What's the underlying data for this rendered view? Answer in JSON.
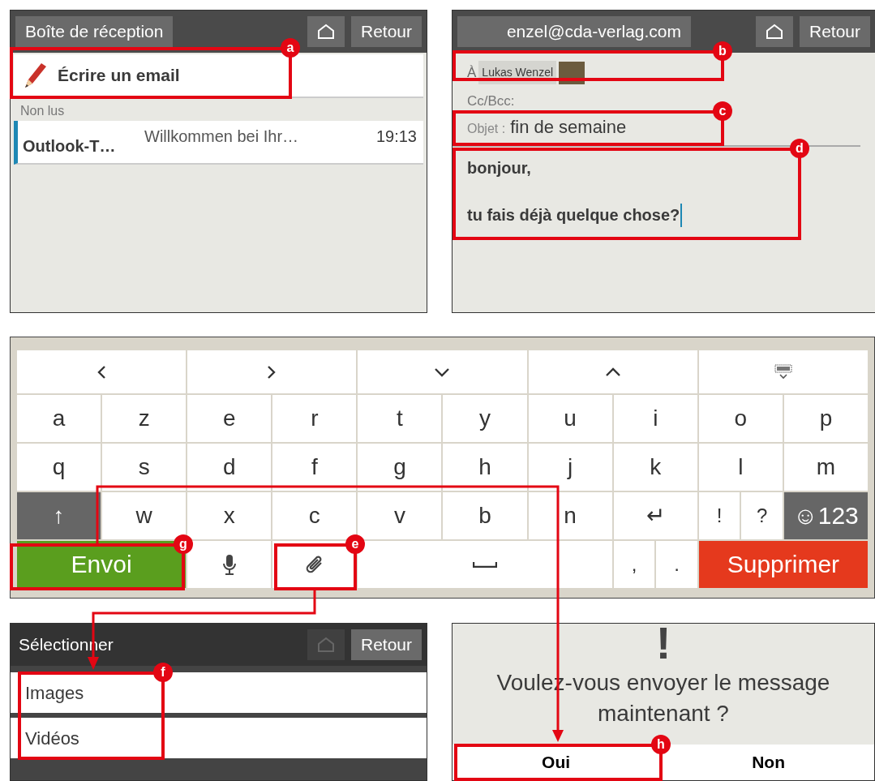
{
  "inbox_screen": {
    "title_button": "Boîte de réception",
    "back_button": "Retour",
    "compose_label": "Écrire un email",
    "section": "Non lus",
    "messages": [
      {
        "sender": "Outlook-T…",
        "preview": "Willkommen bei Ihr…",
        "time": "19:13",
        "unread": true
      }
    ]
  },
  "compose_screen": {
    "account_button": "enzel@cda-verlag.com",
    "back_button": "Retour",
    "to_label": "À",
    "recipient": "Lukas Wenzel",
    "cc_label": "Cc/Bcc:",
    "subject_label": "Objet :",
    "subject": "fin de semaine",
    "body": [
      "bonjour,",
      "tu fais déjà quelque chose?"
    ]
  },
  "keyboard": {
    "rows": [
      {
        "keys": [
          {
            "kind": "left"
          },
          {
            "kind": "right"
          },
          {
            "kind": "down"
          },
          {
            "kind": "up"
          },
          {
            "kind": "hide"
          }
        ]
      },
      {
        "keys": [
          {
            "kind": "letter",
            "label": "a"
          },
          {
            "kind": "letter",
            "label": "z"
          },
          {
            "kind": "letter",
            "label": "e"
          },
          {
            "kind": "letter",
            "label": "r"
          },
          {
            "kind": "letter",
            "label": "t"
          },
          {
            "kind": "letter",
            "label": "y"
          },
          {
            "kind": "letter",
            "label": "u"
          },
          {
            "kind": "letter",
            "label": "i"
          },
          {
            "kind": "letter",
            "label": "o"
          },
          {
            "kind": "letter",
            "label": "p"
          }
        ]
      },
      {
        "keys": [
          {
            "kind": "letter",
            "label": "q"
          },
          {
            "kind": "letter",
            "label": "s"
          },
          {
            "kind": "letter",
            "label": "d"
          },
          {
            "kind": "letter",
            "label": "f"
          },
          {
            "kind": "letter",
            "label": "g"
          },
          {
            "kind": "letter",
            "label": "h"
          },
          {
            "kind": "letter",
            "label": "j"
          },
          {
            "kind": "letter",
            "label": "k"
          },
          {
            "kind": "letter",
            "label": "l"
          },
          {
            "kind": "letter",
            "label": "m"
          }
        ]
      },
      {
        "keys": [
          {
            "kind": "shift",
            "label": "↑"
          },
          {
            "kind": "letter",
            "label": "w"
          },
          {
            "kind": "letter",
            "label": "x"
          },
          {
            "kind": "letter",
            "label": "c"
          },
          {
            "kind": "letter",
            "label": "v"
          },
          {
            "kind": "letter",
            "label": "b"
          },
          {
            "kind": "letter",
            "label": "n"
          },
          {
            "kind": "enter",
            "label": "↵"
          },
          {
            "kind": "narrow",
            "label": "!"
          },
          {
            "kind": "narrow",
            "label": "?"
          },
          {
            "kind": "mode",
            "label": "☺123"
          }
        ]
      },
      {
        "keys": [
          {
            "kind": "send",
            "label": "Envoi"
          },
          {
            "kind": "mic"
          },
          {
            "kind": "attach"
          },
          {
            "kind": "space"
          },
          {
            "kind": "narrow",
            "label": ","
          },
          {
            "kind": "narrow",
            "label": "."
          },
          {
            "kind": "delete",
            "label": "Supprimer"
          }
        ]
      }
    ]
  },
  "picker_screen": {
    "title": "Sélectionner",
    "back_button": "Retour",
    "home_disabled": true,
    "options": [
      "Images",
      "Vidéos"
    ]
  },
  "dialog": {
    "icon": "!",
    "message": "Voulez-vous envoyer le message maintenant ?",
    "buttons": [
      "Oui",
      "Non"
    ]
  },
  "callouts": [
    "a",
    "b",
    "c",
    "d",
    "g",
    "e",
    "f",
    "h"
  ]
}
